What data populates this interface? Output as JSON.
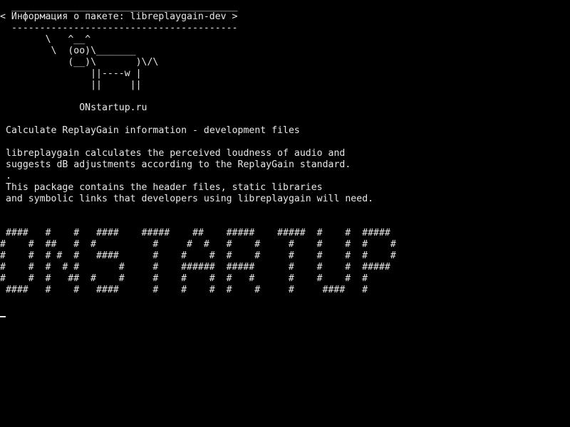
{
  "cowsay": {
    "border_top": " ________________________________________",
    "message": "< Информация о пакете: libreplaygain-dev >",
    "border_bottom": " ----------------------------------------",
    "cow": [
      "       \\   ^__^",
      "        \\  (oo)\\_______",
      "           (__)\\       )\\/\\",
      "               ||----w |",
      "               ||     ||"
    ],
    "site": "             ONstartup.ru"
  },
  "package": {
    "summary": "Calculate ReplayGain information - development files",
    "description": [
      "libreplaygain calculates the perceived loudness of audio and",
      "suggests dB adjustments according to the ReplayGain standard.",
      ".",
      "This package contains the header files, static libraries",
      "and symbolic links that developers using libreplaygain will need."
    ]
  },
  "banner": {
    "lines": [
      " ####   #    #   ####    #####    ##    #####    #####  #    #  #####",
      "#    #  ##   #  #          #     #  #   #    #     #    #    #  #    #",
      "#    #  # #  #   ####      #    #    #  #    #     #    #    #  #    #",
      "#    #  #  # #       #     #    ######  #####      #    #    #  #####",
      "#    #  #   ##  #    #     #    #    #  #   #      #    #    #  #",
      " ####   #    #   ####      #    #    #  #    #     #     ####   #"
    ]
  },
  "colors": {
    "background": "#000000",
    "foreground": "#e8e8e8"
  }
}
